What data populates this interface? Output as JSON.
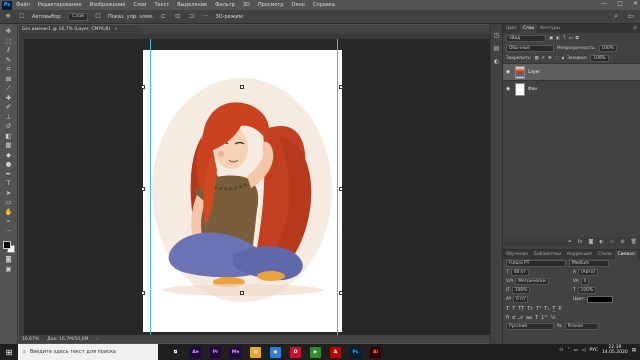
{
  "app": {
    "logo_text": "Ps"
  },
  "menu": [
    "Файл",
    "Редактирование",
    "Изображение",
    "Слои",
    "Текст",
    "Выделение",
    "Фильтр",
    "3D",
    "Просмотр",
    "Окно",
    "Справка"
  ],
  "window_controls": {
    "minimize": "—",
    "maximize": "□",
    "close": "✕"
  },
  "options_bar": {
    "mode_label": "Слой",
    "auto_select": "Автовыбор:",
    "show_controls": "Показ. упр. элем.",
    "three_d_mode": "3D-режим:"
  },
  "document": {
    "tab_title": "Без имени-1 @ 16,7% (Layer, CMYK/8)",
    "close_glyph": "×"
  },
  "status": {
    "zoom": "16,67%",
    "doc_info": "Док: 16,7М/50,6М"
  },
  "panels": {
    "tabs": [
      "Цвет",
      "Слои",
      "Контуры"
    ],
    "active_tab_index": 1,
    "kind_filter": "Вид",
    "blend_mode": "Обычные",
    "opacity_label": "Непрозрачность:",
    "opacity_value": "100%",
    "lock_label": "Закрепить:",
    "fill_label": "Заливка:",
    "fill_value": "100%",
    "layers": [
      {
        "name": "Layer",
        "visible": true,
        "selected": true
      },
      {
        "name": "Фон",
        "visible": true,
        "selected": false
      }
    ]
  },
  "character_panel": {
    "tabs": [
      "Обучение",
      "Библиотеки",
      "Коррекция",
      "Стили",
      "Символ"
    ],
    "active_tab_index": 4,
    "font_family": "Futura PT",
    "font_style": "Medium",
    "font_size": "48 пт",
    "leading": "(Авто)",
    "kerning": "Метрически",
    "tracking": "0",
    "vertical_scale": "100%",
    "horizontal_scale": "100%",
    "baseline_shift": "0 пт",
    "color_label": "Цвет:",
    "language": "Русский",
    "antialias": "Резкое"
  },
  "taskbar": {
    "search_placeholder": "Введите здесь текст для поиска",
    "apps": [
      {
        "name": "task-view",
        "label": "⧉",
        "color": "#1f1f1f",
        "text_color": "#ffffff"
      },
      {
        "name": "after-effects",
        "label": "Ae",
        "color": "#1f0740",
        "text_color": "#d8a0ff"
      },
      {
        "name": "premiere",
        "label": "Pr",
        "color": "#1f0740",
        "text_color": "#d8a0ff"
      },
      {
        "name": "media-encoder",
        "label": "Me",
        "color": "#1f0740",
        "text_color": "#d8a0ff"
      },
      {
        "name": "explorer",
        "label": "▤",
        "color": "#e5a823",
        "text_color": "#ffffff"
      },
      {
        "name": "chrome",
        "label": "●",
        "color": "#2a7de1",
        "text_color": "#fde14a"
      },
      {
        "name": "opera",
        "label": "O",
        "color": "#c4122f",
        "text_color": "#ffffff"
      },
      {
        "name": "player",
        "label": "▶",
        "color": "#2d8c2d",
        "text_color": "#ffffff"
      },
      {
        "name": "acrobat",
        "label": "A",
        "color": "#b30b00",
        "text_color": "#ffffff"
      },
      {
        "name": "photoshop",
        "label": "Ps",
        "color": "#001e36",
        "text_color": "#31a8ff"
      },
      {
        "name": "illustrator",
        "label": "Ai",
        "color": "#330000",
        "text_color": "#ff9a00"
      }
    ],
    "language": "РУС",
    "time": "22:39",
    "date": "14.05.2020"
  },
  "colors": {
    "guide": "#3fbbdd",
    "panel_bg": "#424242",
    "canvas_bg": "#282828"
  }
}
